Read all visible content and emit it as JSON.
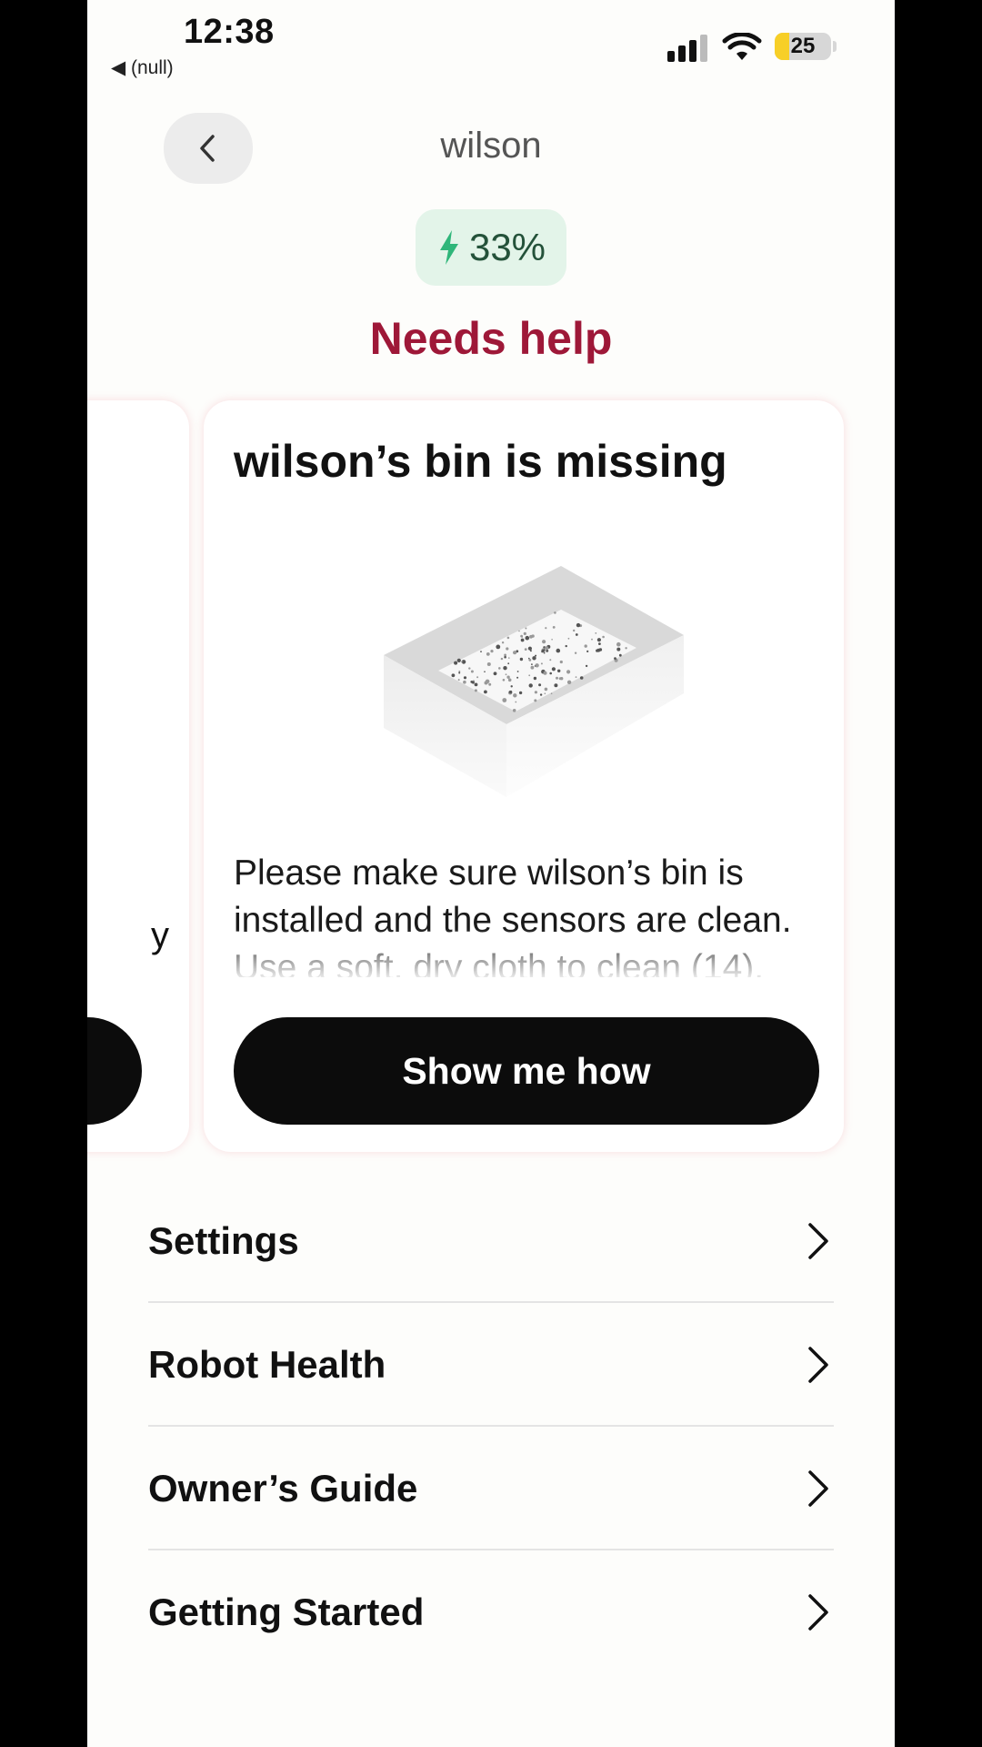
{
  "status_bar": {
    "time": "12:38",
    "back_app": "◀ (null)",
    "battery_level": "25",
    "battery_fraction": 0.25,
    "signal_bars_active": 3,
    "signal_bars_total": 4
  },
  "header": {
    "title": "wilson",
    "back_icon": "chevron-left-icon"
  },
  "robot": {
    "battery_percent": "33%",
    "charging_icon": "lightning-bolt-icon",
    "status": "Needs help",
    "status_color": "#9e1838"
  },
  "carousel": {
    "previous_card_fragment": "y",
    "current_card": {
      "title": "wilson’s bin is missing",
      "image": "bin-illustration",
      "body": "Please make sure wilson’s bin is installed and the sensors are clean. Use a soft, dry cloth to clean (14).",
      "button_label": "Show me how"
    }
  },
  "menu": {
    "items": [
      {
        "label": "Settings"
      },
      {
        "label": "Robot Health"
      },
      {
        "label": "Owner’s Guide"
      },
      {
        "label": "Getting Started"
      }
    ]
  }
}
